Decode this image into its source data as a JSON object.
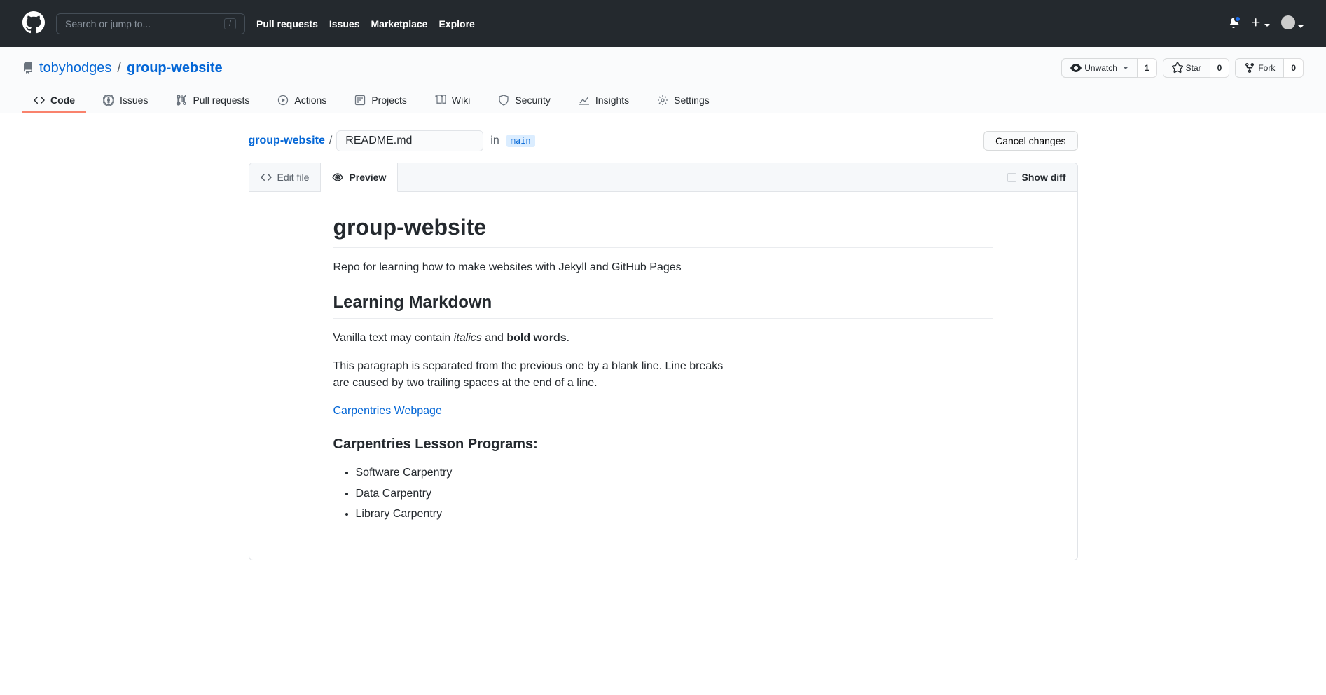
{
  "header": {
    "search_placeholder": "Search or jump to...",
    "slash": "/",
    "nav": [
      "Pull requests",
      "Issues",
      "Marketplace",
      "Explore"
    ]
  },
  "repo": {
    "owner": "tobyhodges",
    "name": "group-website",
    "unwatch": "Unwatch",
    "watch_count": "1",
    "star": "Star",
    "star_count": "0",
    "fork": "Fork",
    "fork_count": "0"
  },
  "tabs": {
    "code": "Code",
    "issues": "Issues",
    "pulls": "Pull requests",
    "actions": "Actions",
    "projects": "Projects",
    "wiki": "Wiki",
    "security": "Security",
    "insights": "Insights",
    "settings": "Settings"
  },
  "breadcrumb": {
    "root": "group-website",
    "filename": "README.md",
    "in": "in",
    "branch": "main",
    "cancel": "Cancel changes"
  },
  "editor": {
    "edit_tab": "Edit file",
    "preview_tab": "Preview",
    "show_diff": "Show diff"
  },
  "content": {
    "h1": "group-website",
    "p1": "Repo for learning how to make websites with Jekyll and GitHub Pages",
    "h2": "Learning Markdown",
    "p2a": "Vanilla text may contain ",
    "p2b": "italics",
    "p2c": " and ",
    "p2d": "bold words",
    "p2e": ".",
    "p3": "This paragraph is separated from the previous one by a blank line. Line breaks are caused by two trailing spaces at the end of a line.",
    "link": "Carpentries Webpage",
    "h3": "Carpentries Lesson Programs:",
    "list": [
      "Software Carpentry",
      "Data Carpentry",
      "Library Carpentry"
    ]
  }
}
